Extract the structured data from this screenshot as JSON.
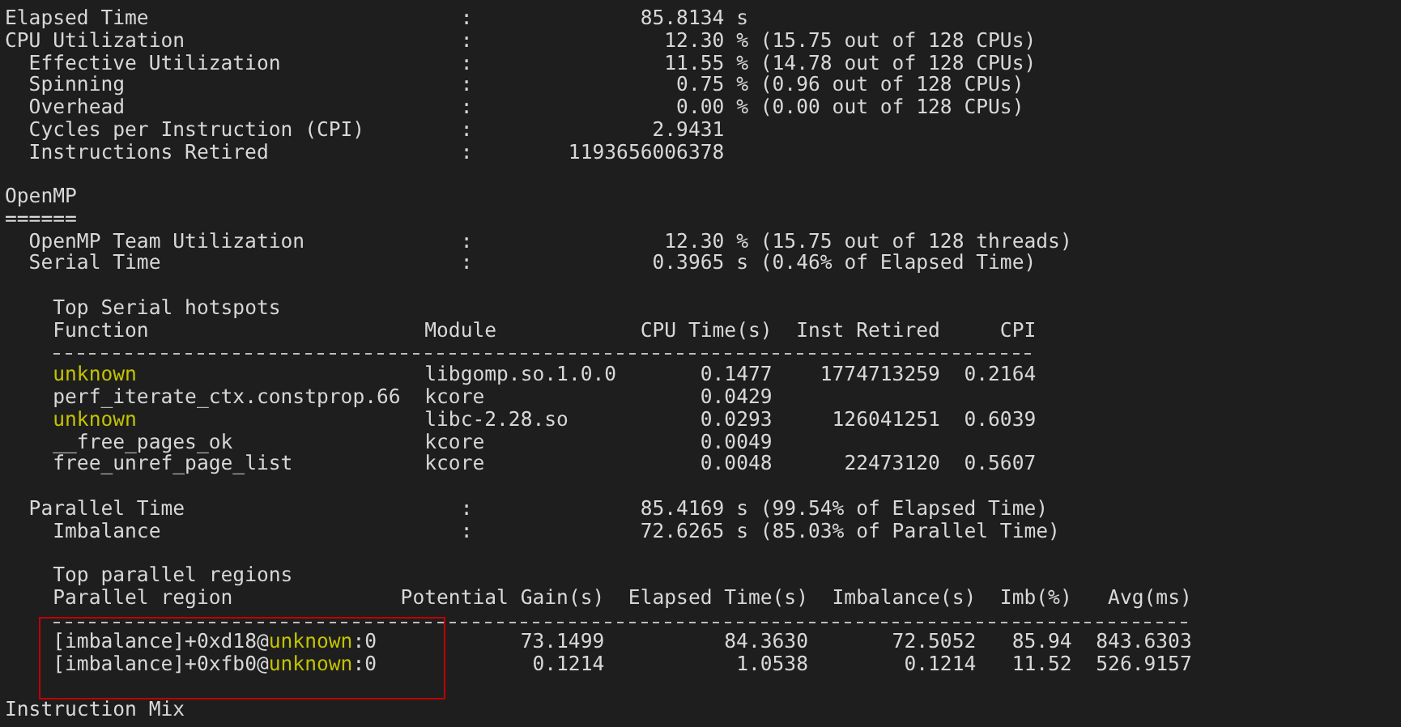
{
  "summary": [
    {
      "label": "Elapsed Time",
      "separator": ":",
      "value": "85.8134",
      "detail": "s"
    },
    {
      "label": "CPU Utilization",
      "separator": ":",
      "value": "12.30",
      "detail": "% (15.75 out of 128 CPUs)",
      "children": [
        {
          "label": "Effective Utilization",
          "separator": ":",
          "value": "11.55",
          "detail": "% (14.78 out of 128 CPUs)"
        },
        {
          "label": "Spinning",
          "separator": ":",
          "value": "0.75",
          "detail": "% (0.96 out of 128 CPUs)"
        },
        {
          "label": "Overhead",
          "separator": ":",
          "value": "0.00",
          "detail": "% (0.00 out of 128 CPUs)"
        },
        {
          "label": "Cycles per Instruction (CPI)",
          "separator": ":",
          "value": "2.9431"
        },
        {
          "label": "Instructions Retired",
          "separator": ":",
          "value": "1193656006378"
        }
      ]
    }
  ],
  "openmp": {
    "title": "OpenMP",
    "underline": "======",
    "metrics": [
      {
        "label": "OpenMP Team Utilization",
        "separator": ":",
        "value": "12.30",
        "detail": "% (15.75 out of 128 threads)"
      },
      {
        "label": "Serial Time",
        "separator": ":",
        "value": "0.3965",
        "detail": "s (0.46% of Elapsed Time)"
      }
    ],
    "serial_hotspots": {
      "title": "Top Serial hotspots",
      "columns": [
        "Function",
        "Module",
        "CPU Time(s)",
        "Inst Retired",
        "CPI"
      ],
      "rows": [
        {
          "function": "unknown",
          "highlighted": true,
          "module": "libgomp.so.1.0.0",
          "cpu_time": "0.1477",
          "inst_retired": "1774713259",
          "cpi": "0.2164"
        },
        {
          "function": "perf_iterate_ctx.constprop.66",
          "highlighted": false,
          "module": "kcore",
          "cpu_time": "0.0429"
        },
        {
          "function": "unknown",
          "highlighted": true,
          "module": "libc-2.28.so",
          "cpu_time": "0.0293",
          "inst_retired": "126041251",
          "cpi": "0.6039"
        },
        {
          "function": "__free_pages_ok",
          "highlighted": false,
          "module": "kcore",
          "cpu_time": "0.0049"
        },
        {
          "function": "free_unref_page_list",
          "highlighted": false,
          "module": "kcore",
          "cpu_time": "0.0048",
          "inst_retired": "22473120",
          "cpi": "0.5607"
        }
      ]
    },
    "parallel_metrics": [
      {
        "label": "Parallel Time",
        "separator": ":",
        "value": "85.4169",
        "detail": "s (99.54% of Elapsed Time)",
        "children": [
          {
            "label": "Imbalance",
            "separator": ":",
            "value": "72.6265",
            "detail": "s (85.03% of Parallel Time)"
          }
        ]
      }
    ],
    "parallel_regions": {
      "title": "Top parallel regions",
      "framed": true,
      "columns": [
        "Parallel region",
        "Potential Gain(s)",
        "Elapsed Time(s)",
        "Imbalance(s)",
        "Imb(%)",
        "Avg(ms)"
      ],
      "rows": [
        {
          "prefix": "[imbalance]+0xd18@",
          "symbol": "unknown",
          "suffix": ":0",
          "highlighted": true,
          "gain": "73.1499",
          "elapsed": "84.3630",
          "imbalance": "72.5052",
          "imb_pct": "85.94",
          "avg": "843.6303"
        },
        {
          "prefix": "[imbalance]+0xfb0@",
          "symbol": "unknown",
          "suffix": ":0",
          "highlighted": true,
          "gain": "0.1214",
          "elapsed": "1.0538",
          "imbalance": "0.1214",
          "imb_pct": "11.52",
          "avg": "526.9157"
        }
      ]
    }
  },
  "next_section": "Instruction Mix"
}
